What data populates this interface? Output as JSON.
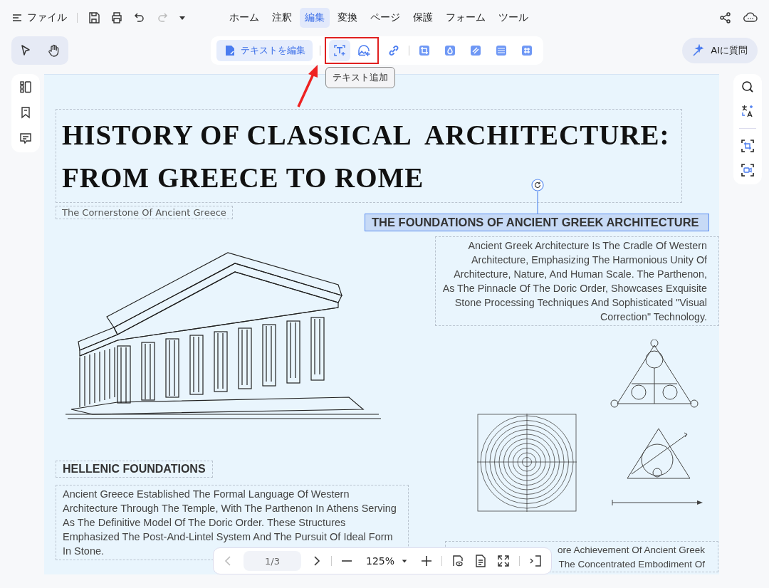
{
  "menu": {
    "file_label": "ファイル",
    "tabs": [
      {
        "label": "ホーム",
        "selected": false
      },
      {
        "label": "注釈",
        "selected": false
      },
      {
        "label": "編集",
        "selected": true
      },
      {
        "label": "変換",
        "selected": false
      },
      {
        "label": "ページ",
        "selected": false
      },
      {
        "label": "保護",
        "selected": false
      },
      {
        "label": "フォーム",
        "selected": false
      },
      {
        "label": "ツール",
        "selected": false
      }
    ]
  },
  "toolbar": {
    "edit_text_button": "テキストを編集",
    "tooltip": "テキスト追加",
    "ai_button": "AIに質問"
  },
  "document": {
    "title_lines": [
      "HISTORY OF CLASSICAL  ARCHITECTURE:",
      "FROM GREECE TO ROME"
    ],
    "subtitle": "The Cornerstone Of Ancient Greece",
    "heading_right": {
      "text": "THE FOUNDATIONS OF ANCIENT GREEK ARCHITECTURE",
      "selected": true
    },
    "paragraph_right": "Ancient Greek Architecture Is The Cradle Of Western Architecture, Emphasizing The Harmonious Unity Of Architecture, Nature, And Human Scale. The Parthenon, As The Pinnacle Of The Doric Order, Showcases Exquisite Stone Processing Techniques And Sophisticated \"Visual Correction\" Technology.",
    "heading_left": "HELLENIC FOUNDATIONS",
    "paragraph_left": "Ancient Greece Established The Formal Language Of Western Architecture Through The Temple, With The Parthenon In Athens Serving As The Definitive Model Of The Doric Order. These Structures Emphasized The Post-And-Lintel System And The Pursuit Of Ideal Form In Stone.",
    "paragraph_bottom_lines": [
      "ore Achievement Of Ancient Greek",
      "The Concentrated Embodiment Of"
    ]
  },
  "zoom_bar": {
    "page": "1/3",
    "zoom": "125%"
  }
}
